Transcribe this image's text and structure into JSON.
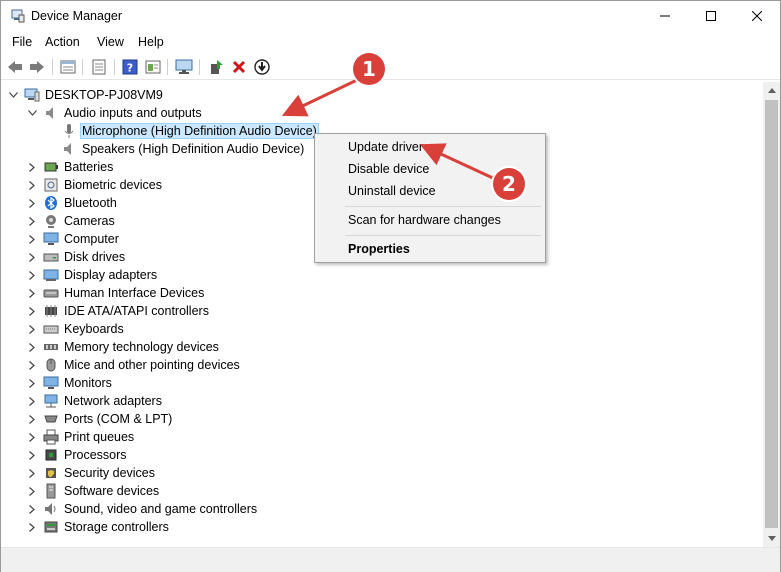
{
  "window": {
    "title": "Device Manager",
    "controls": [
      "minimize",
      "maximize",
      "close"
    ]
  },
  "menu": {
    "items": [
      "File",
      "Action",
      "View",
      "Help"
    ]
  },
  "toolbar": {
    "buttons": [
      "back-icon",
      "forward-icon",
      "properties-list-icon",
      "console-tree-icon",
      "help-icon",
      "details-icon",
      "monitor-icon",
      "update-driver-icon",
      "uninstall-icon",
      "download-icon"
    ]
  },
  "tree": {
    "root": "DESKTOP-PJ08VM9",
    "audio": {
      "label": "Audio inputs and outputs",
      "children": [
        "Microphone (High Definition Audio Device)",
        "Speakers (High Definition Audio Device)"
      ]
    },
    "categories": [
      "Batteries",
      "Biometric devices",
      "Bluetooth",
      "Cameras",
      "Computer",
      "Disk drives",
      "Display adapters",
      "Human Interface Devices",
      "IDE ATA/ATAPI controllers",
      "Keyboards",
      "Memory technology devices",
      "Mice and other pointing devices",
      "Monitors",
      "Network adapters",
      "Ports (COM & LPT)",
      "Print queues",
      "Processors",
      "Security devices",
      "Software devices",
      "Sound, video and game controllers",
      "Storage controllers"
    ]
  },
  "context_menu": {
    "update_driver": "Update driver",
    "disable_device": "Disable device",
    "uninstall_device": "Uninstall device",
    "scan": "Scan for hardware changes",
    "properties": "Properties"
  },
  "annotations": {
    "step1": "1",
    "step2": "2",
    "color": "#d9403a"
  }
}
